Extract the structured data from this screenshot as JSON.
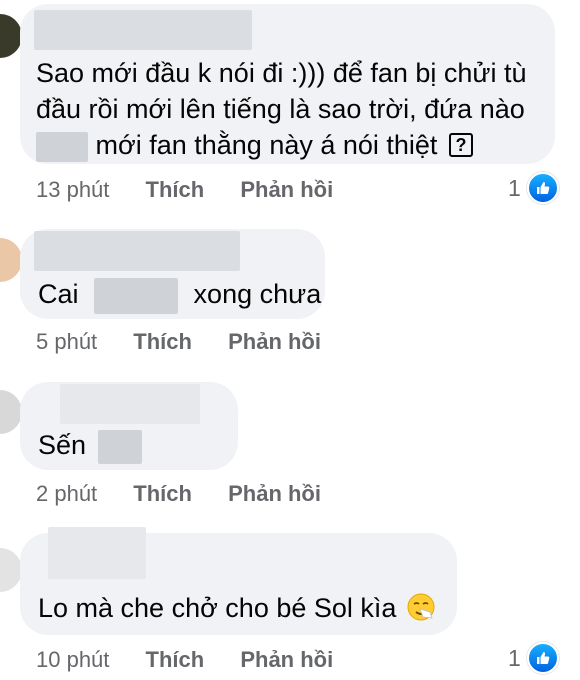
{
  "comments": [
    {
      "text_line1": "Sao mới đầu k nói đi :))) để fan bị chửi tù",
      "text_line2": "đầu rồi mới lên tiếng là sao trời, đứa nào",
      "text_line3": "mới fan thằng này á nói thiệt",
      "question_icon_text": "?",
      "time": "13 phút",
      "like_label": "Thích",
      "reply_label": "Phản hồi",
      "reaction_count": "1"
    },
    {
      "text_before": "Cai",
      "text_after": "xong chưa",
      "time": "5 phút",
      "like_label": "Thích",
      "reply_label": "Phản hồi"
    },
    {
      "text_before": "Sến",
      "time": "2 phút",
      "like_label": "Thích",
      "reply_label": "Phản hồi"
    },
    {
      "text": "Lo mà che chở cho bé Sol kìa",
      "emoji": "sneezing-face-emoji",
      "time": "10 phút",
      "like_label": "Thích",
      "reply_label": "Phản hồi",
      "reaction_count": "1"
    }
  ],
  "colors": {
    "bubble": "#f0f2f5",
    "meta_text": "#65676b",
    "like_blue": "#0571ed"
  },
  "icons": {
    "like_reaction": "thumbs-up-icon"
  }
}
